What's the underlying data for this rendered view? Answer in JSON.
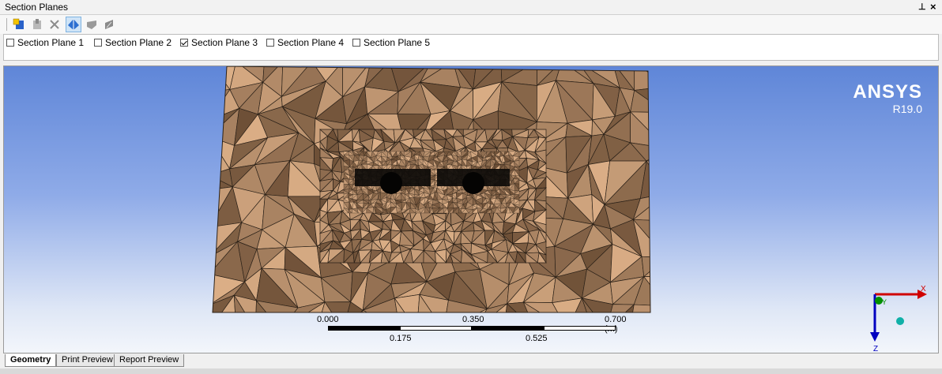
{
  "panel": {
    "title": "Section Planes",
    "pin_icon": "pin-icon",
    "close_label": "×"
  },
  "toolbar": {
    "buttons": [
      {
        "name": "new-section-plane-icon"
      },
      {
        "name": "edit-section-plane-icon"
      },
      {
        "name": "delete-section-plane-icon"
      },
      {
        "name": "show-whole-elements-icon",
        "active": true
      },
      {
        "name": "show-section-icon"
      },
      {
        "name": "cap-section-icon"
      }
    ]
  },
  "section_planes": [
    {
      "label": "Section Plane 1",
      "checked": false
    },
    {
      "label": "Section Plane 2",
      "checked": false
    },
    {
      "label": "Section Plane 3",
      "checked": true
    },
    {
      "label": "Section Plane 4",
      "checked": false
    },
    {
      "label": "Section Plane 5",
      "checked": false
    }
  ],
  "viewport": {
    "brand": "ANSYS",
    "version": "R19.0",
    "scale": {
      "top_labels": [
        "0.000",
        "0.350",
        "0.700 (m)"
      ],
      "bottom_labels": [
        "0.175",
        "0.525"
      ]
    },
    "triad": {
      "x_label": "X",
      "y_label": "Y",
      "z_label": "Z"
    },
    "colors": {
      "mesh_fill": "#c9a47e",
      "mesh_edge": "#2b2118",
      "x_axis": "#d00000",
      "y_axis": "#009000",
      "z_axis": "#0000c0"
    }
  },
  "tabs": [
    {
      "label": "Geometry",
      "active": true
    },
    {
      "label": "Print Preview",
      "active": false
    },
    {
      "label": "Report Preview",
      "active": false
    }
  ]
}
